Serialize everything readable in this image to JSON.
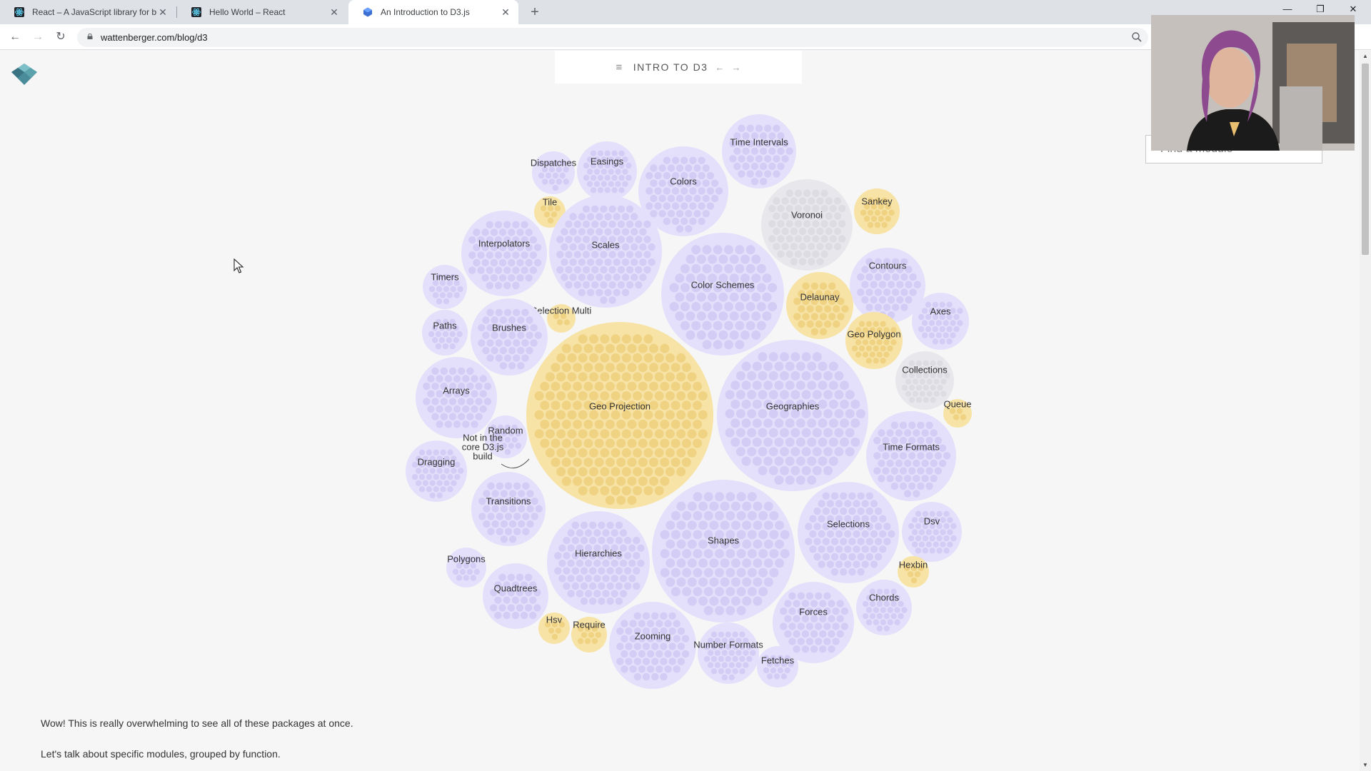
{
  "browser": {
    "tabs": [
      {
        "title": "React – A JavaScript library for bu",
        "icon": "react-icon",
        "active": false
      },
      {
        "title": "Hello World – React",
        "icon": "react-icon",
        "active": false
      },
      {
        "title": "An Introduction to D3.js",
        "icon": "wattenberger-icon",
        "active": true
      }
    ],
    "new_tab_label": "+",
    "url": "wattenberger.com/blog/d3"
  },
  "page": {
    "toc_label": "INTRO TO D3",
    "search_placeholder": "Find a module",
    "paragraphs": [
      "Wow! This is really overwhelming to see all of these packages at once.",
      "Let's talk about specific modules, grouped by function."
    ],
    "not_in_core_label": [
      "Not in the",
      "core D3.js",
      "build"
    ],
    "modules": [
      {
        "label": "Time Intervals",
        "core": true
      },
      {
        "label": "Dispatches",
        "core": true
      },
      {
        "label": "Easings",
        "core": true
      },
      {
        "label": "Colors",
        "core": true
      },
      {
        "label": "Tile",
        "core": false
      },
      {
        "label": "Voronoi",
        "core": "neutral"
      },
      {
        "label": "Sankey",
        "core": false
      },
      {
        "label": "Interpolators",
        "core": true
      },
      {
        "label": "Scales",
        "core": true
      },
      {
        "label": "Timers",
        "core": true
      },
      {
        "label": "Color Schemes",
        "core": true
      },
      {
        "label": "Contours",
        "core": true
      },
      {
        "label": "Delaunay",
        "core": false
      },
      {
        "label": "Selection Multi",
        "core": false
      },
      {
        "label": "Axes",
        "core": true
      },
      {
        "label": "Paths",
        "core": true
      },
      {
        "label": "Brushes",
        "core": true
      },
      {
        "label": "Geo Polygon",
        "core": false
      },
      {
        "label": "Collections",
        "core": "neutral"
      },
      {
        "label": "Arrays",
        "core": true
      },
      {
        "label": "Geo Projection",
        "core": false
      },
      {
        "label": "Geographies",
        "core": true
      },
      {
        "label": "Queue",
        "core": false
      },
      {
        "label": "Random",
        "core": true
      },
      {
        "label": "Dragging",
        "core": true
      },
      {
        "label": "Time Formats",
        "core": true
      },
      {
        "label": "Transitions",
        "core": true
      },
      {
        "label": "Selections",
        "core": true
      },
      {
        "label": "Dsv",
        "core": true
      },
      {
        "label": "Hierarchies",
        "core": true
      },
      {
        "label": "Shapes",
        "core": true
      },
      {
        "label": "Polygons",
        "core": true
      },
      {
        "label": "Hexbin",
        "core": false
      },
      {
        "label": "Quadtrees",
        "core": true
      },
      {
        "label": "Chords",
        "core": true
      },
      {
        "label": "Forces",
        "core": true
      },
      {
        "label": "Hsv",
        "core": false
      },
      {
        "label": "Require",
        "core": false
      },
      {
        "label": "Zooming",
        "core": true
      },
      {
        "label": "Number Formats",
        "core": true
      },
      {
        "label": "Fetches",
        "core": true
      }
    ]
  },
  "colors": {
    "core_circle": "#e4e0fb",
    "core_dot": "#d3ccf5",
    "noncore_circle": "#f7e3a6",
    "noncore_dot": "#f0d283",
    "neutral_circle": "#e8e8ec",
    "neutral_dot": "#dcdce2",
    "logo": "#4a8c9a"
  }
}
